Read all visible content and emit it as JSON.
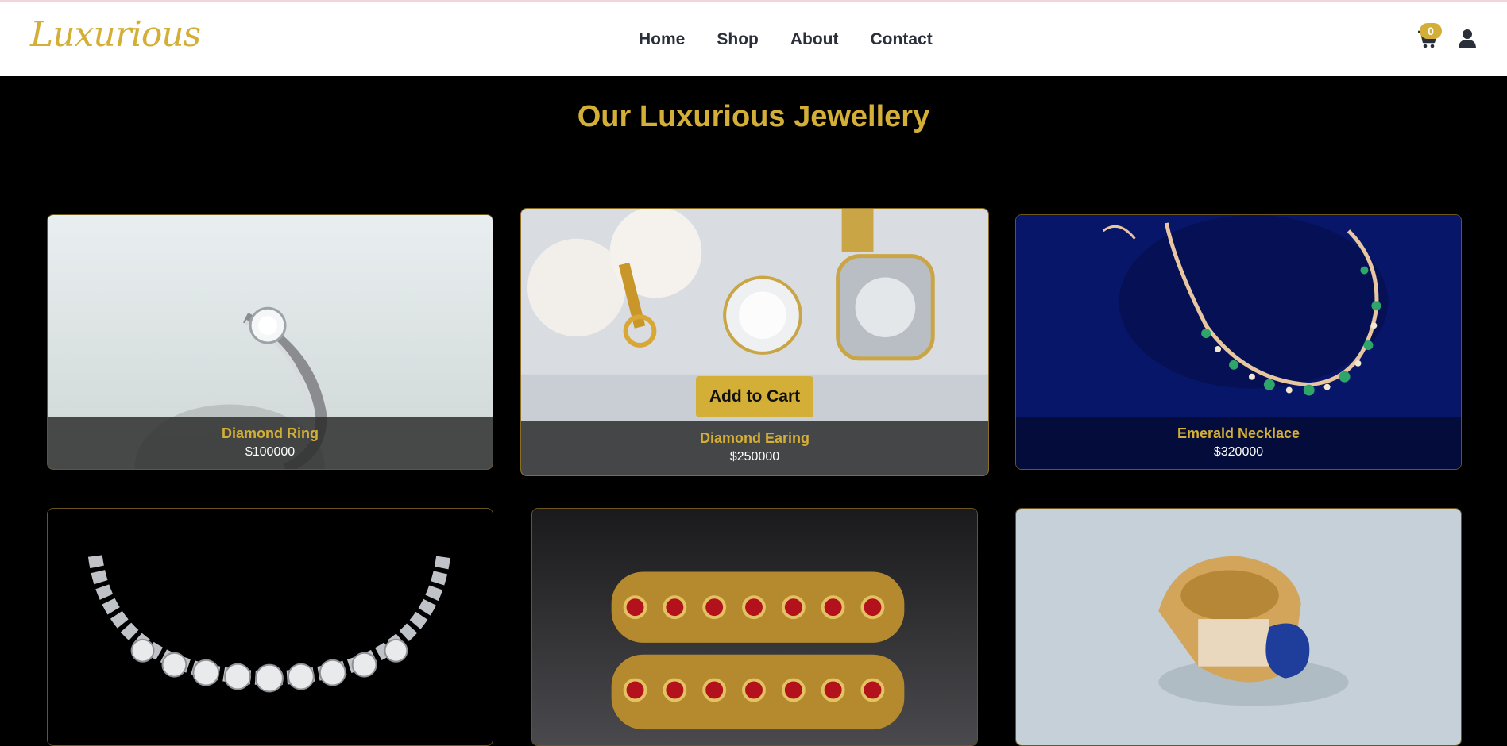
{
  "header": {
    "logo": "Luxurious",
    "nav": [
      "Home",
      "Shop",
      "About",
      "Contact"
    ],
    "cart_count": "0"
  },
  "section": {
    "title": "Our Luxurious Jewellery"
  },
  "products": [
    {
      "name": "Diamond Ring",
      "price": "$100000"
    },
    {
      "name": "Diamond Earing",
      "price": "$250000",
      "button": "Add to Cart"
    },
    {
      "name": "Emerald Necklace",
      "price": "$320000"
    }
  ],
  "colors": {
    "accent": "#d4af37",
    "background": "#000000",
    "header": "#ffffff"
  }
}
